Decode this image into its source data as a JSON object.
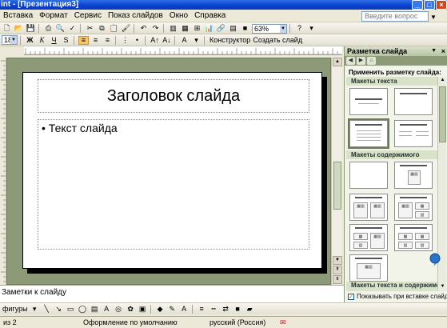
{
  "window": {
    "title": "int - [Презентация3]"
  },
  "menu": [
    "Вставка",
    "Формат",
    "Сервис",
    "Показ слайдов",
    "Окно",
    "Справка"
  ],
  "help_placeholder": "Введите вопрос",
  "toolbar": {
    "zoom": "63%",
    "font_size": "18",
    "design_label": "Конструктор",
    "new_slide_label": "Создать слайд"
  },
  "slide": {
    "title": "Заголовок слайда",
    "bullet": "Текст слайда"
  },
  "notes_placeholder": "Заметки к слайду",
  "drawbar": {
    "autoshapes_label": "фигуры"
  },
  "status": {
    "slide_counter": "из 2",
    "design": "Оформление по умолчанию",
    "language": "русский (Россия)"
  },
  "task_pane": {
    "title": "Разметка слайда",
    "apply_label": "Применить разметку слайда:",
    "groups": [
      "Макеты текста",
      "Макеты содержимого",
      "Макеты текста и содержимого"
    ],
    "show_on_insert": "Показывать при вставке слайдов"
  },
  "icons": {
    "close": "close-icon",
    "minimize": "minimize-icon",
    "maximize": "maximize-icon",
    "help": "help-icon"
  }
}
